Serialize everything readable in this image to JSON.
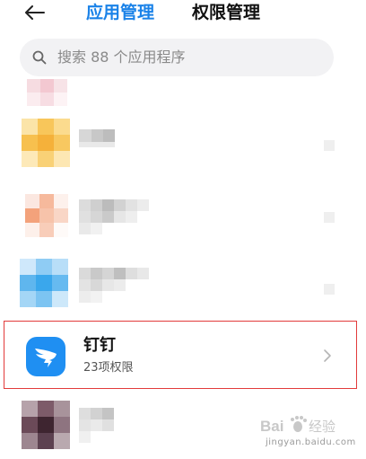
{
  "header": {
    "tabs": [
      {
        "label": "应用管理",
        "active": true
      },
      {
        "label": "权限管理",
        "active": false
      }
    ],
    "accent": "#1a82e8"
  },
  "search": {
    "placeholder": "搜索 88 个应用程序"
  },
  "apps": [
    {
      "name": "钉钉",
      "subtitle": "23项权限",
      "icon": "dingtalk-icon",
      "highlighted": true
    }
  ],
  "watermark": {
    "logo": "Bai 经验",
    "url": "jingyan.baidu.com"
  }
}
